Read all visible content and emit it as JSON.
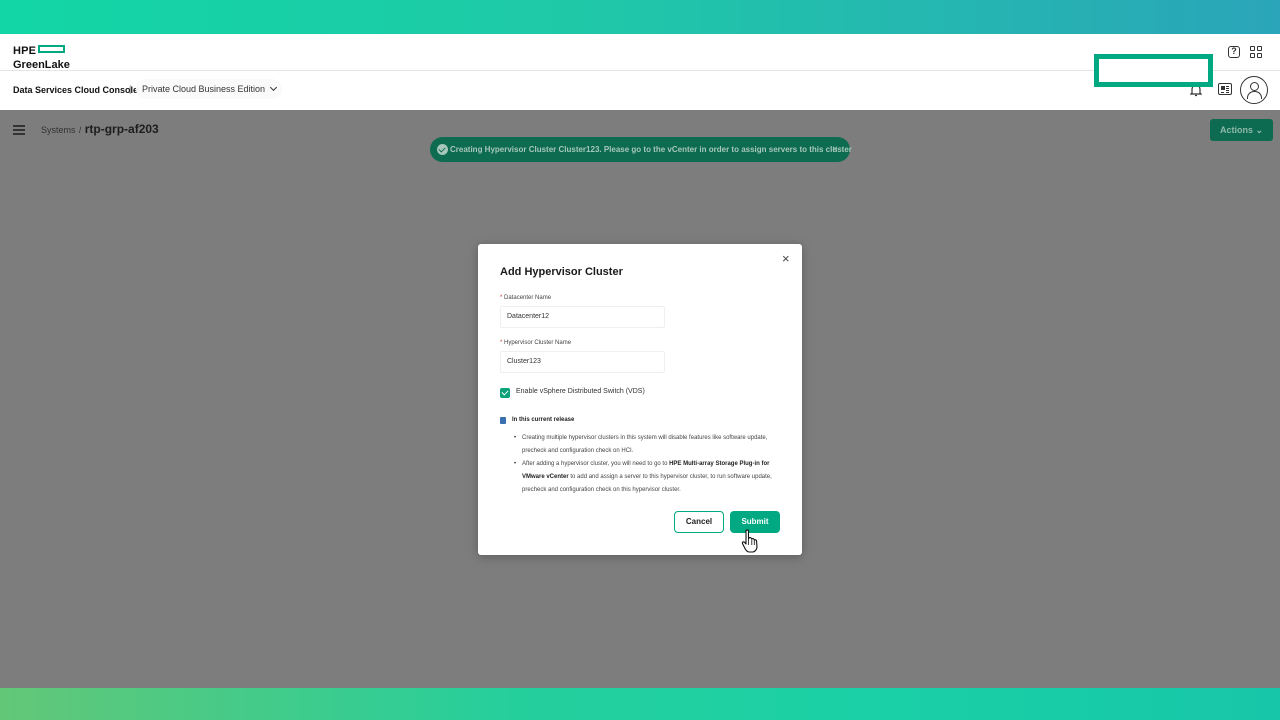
{
  "brand": {
    "hpe": "HPE",
    "greenlake": "GreenLake"
  },
  "header": {
    "console_title": "Data Services Cloud Console",
    "separator": "|",
    "edition": "Private Cloud Business Edition"
  },
  "breadcrumb": {
    "root": "Systems",
    "sep": "/",
    "current": "rtp-grp-af203"
  },
  "actions_label": "Actions",
  "toast": {
    "message": "Creating Hypervisor Cluster Cluster123. Please go to the vCenter in order to assign servers to this cluster",
    "close": "×"
  },
  "modal": {
    "title": "Add Hypervisor Cluster",
    "close": "×",
    "required_mark": "*",
    "datacenter_label": "Datacenter Name",
    "datacenter_value": "Datacenter12",
    "cluster_label": "Hypervisor Cluster Name",
    "cluster_value": "Cluster123",
    "vds_label": "Enable vSphere Distributed Switch (VDS)",
    "vds_checked": true,
    "info_title": "In this current release",
    "bullet1": "Creating multiple hypervisor clusters in this system will disable features like software update, precheck and configuration check on HCI.",
    "bullet2_pre": "After adding a hypervisor cluster, you will need to go to ",
    "bullet2_bold": "HPE Multi-array Storage Plug-in for VMware vCenter",
    "bullet2_post": " to add and assign a server to this hypervisor cluster, to run software update, precheck and configuration check on this hypervisor cluster.",
    "cancel_label": "Cancel",
    "submit_label": "Submit"
  },
  "colors": {
    "accent": "#01a982",
    "toast_bg": "#0d6b4f",
    "overlay": "#7d7d7d"
  }
}
